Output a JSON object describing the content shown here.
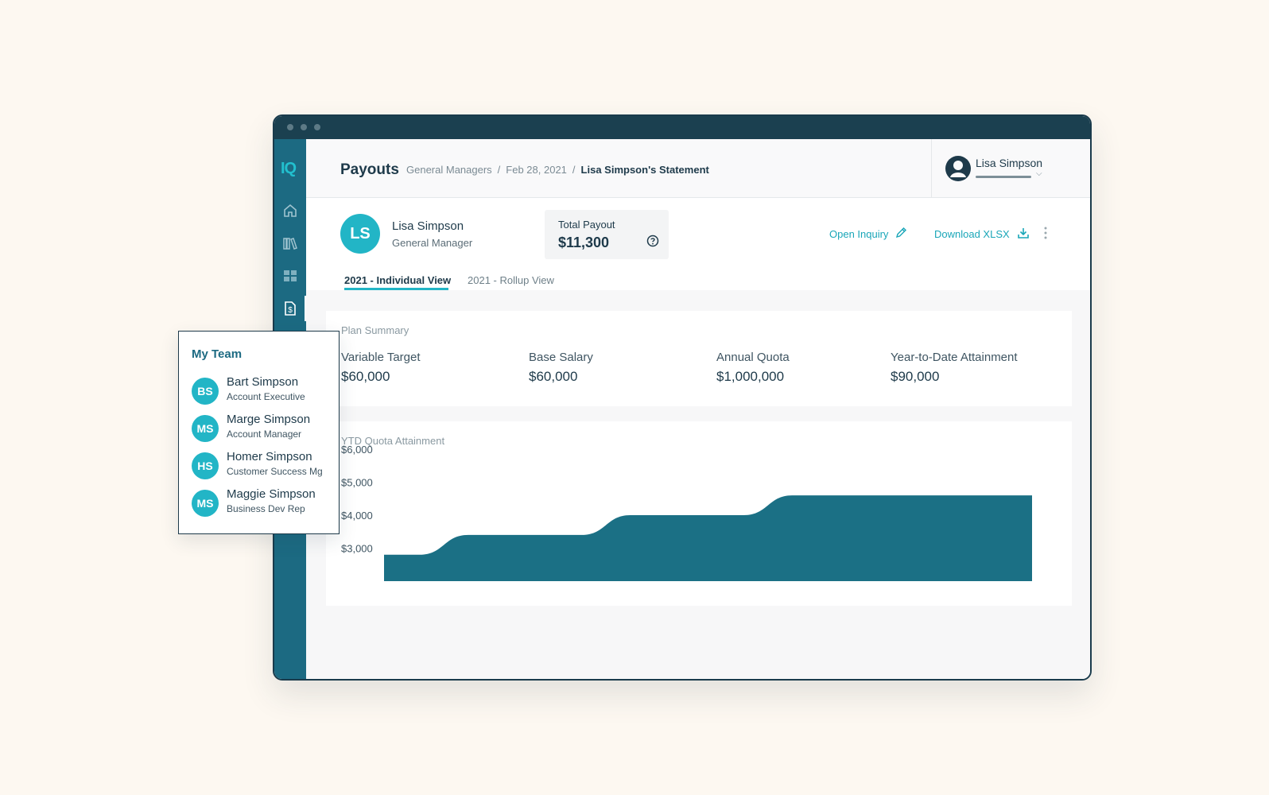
{
  "app": {
    "logo": "IQ",
    "rail_icons": [
      "home-icon",
      "library-icon",
      "grid-icon",
      "payout-document-icon"
    ]
  },
  "header": {
    "title": "Payouts",
    "breadcrumb": [
      "General Managers",
      "Feb 28, 2021",
      "Lisa Simpson's Statement"
    ],
    "user_name": "Lisa Simpson"
  },
  "profile": {
    "initials": "LS",
    "name": "Lisa Simpson",
    "role": "General Manager",
    "total_payout_label": "Total Payout",
    "total_payout_value": "$11,300",
    "open_inquiry": "Open Inquiry",
    "download": "Download XLSX"
  },
  "tabs": [
    "2021 - Individual View",
    "2021 - Rollup View"
  ],
  "plan_summary": {
    "title": "Plan Summary",
    "metrics": [
      {
        "label": "Variable Target",
        "value": "$60,000"
      },
      {
        "label": "Base Salary",
        "value": "$60,000"
      },
      {
        "label": "Annual Quota",
        "value": "$1,000,000"
      },
      {
        "label": "Year-to-Date Attainment",
        "value": "$90,000"
      }
    ]
  },
  "chart_data": {
    "type": "area",
    "title": "YTD  Quota Attainment",
    "y_ticks": [
      "$6,000",
      "$5,000",
      "$4,000",
      "$3,000"
    ],
    "ylim": [
      2000,
      6000
    ],
    "x": [
      0,
      1,
      2,
      3,
      4
    ],
    "values": [
      2800,
      3400,
      4000,
      4600,
      4600
    ],
    "grid": false,
    "legend": "none"
  },
  "team": {
    "title": "My Team",
    "members": [
      {
        "initials": "BS",
        "name": "Bart Simpson",
        "role": "Account Executive"
      },
      {
        "initials": "MS",
        "name": "Marge Simpson",
        "role": "Account Manager"
      },
      {
        "initials": "HS",
        "name": "Homer Simpson",
        "role": "Customer Success Mg"
      },
      {
        "initials": "MS",
        "name": "Maggie Simpson",
        "role": "Business Dev Rep"
      }
    ]
  },
  "colors": {
    "background": "#fdf8f1",
    "titlebar": "#1b4050",
    "rail": "#1c6a82",
    "accent": "#22b5c6",
    "chart_fill": "#1b7085",
    "link": "#1aa6b8"
  }
}
